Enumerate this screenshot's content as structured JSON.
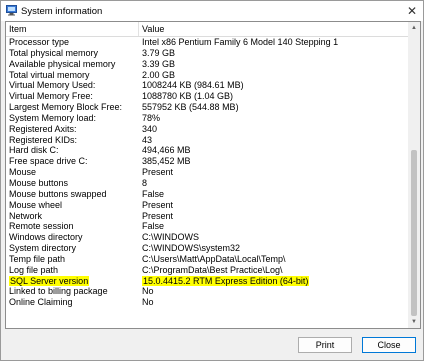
{
  "window": {
    "title": "System information",
    "close_glyph": "✕"
  },
  "table": {
    "columns": {
      "item": "Item",
      "value": "Value"
    },
    "rows": [
      {
        "item": "Processor type",
        "value": "Intel x86 Pentium Family 6 Model 140 Stepping 1"
      },
      {
        "item": "Total physical memory",
        "value": "3.79 GB"
      },
      {
        "item": "Available physical memory",
        "value": "3.39 GB"
      },
      {
        "item": "Total virtual memory",
        "value": "2.00 GB"
      },
      {
        "item": "Virtual Memory Used:",
        "value": "1008244 KB (984.61 MB)"
      },
      {
        "item": "Virtual Memory Free:",
        "value": "1088780 KB (1.04 GB)"
      },
      {
        "item": "Largest Memory Block Free:",
        "value": "557952 KB (544.88 MB)"
      },
      {
        "item": "System Memory load:",
        "value": "78%"
      },
      {
        "item": "Registered Axits:",
        "value": "340"
      },
      {
        "item": "Registered KIDs:",
        "value": "43"
      },
      {
        "item": "Hard disk C:",
        "value": "494,466 MB"
      },
      {
        "item": "Free space drive C:",
        "value": "385,452 MB"
      },
      {
        "item": "Mouse",
        "value": "Present"
      },
      {
        "item": "Mouse buttons",
        "value": "8"
      },
      {
        "item": "Mouse buttons swapped",
        "value": "False"
      },
      {
        "item": "Mouse wheel",
        "value": "Present"
      },
      {
        "item": "Network",
        "value": "Present"
      },
      {
        "item": "Remote session",
        "value": "False"
      },
      {
        "item": "Windows directory",
        "value": "C:\\WINDOWS"
      },
      {
        "item": "System directory",
        "value": "C:\\WINDOWS\\system32"
      },
      {
        "item": "Temp file path",
        "value": "C:\\Users\\Matt\\AppData\\Local\\Temp\\"
      },
      {
        "item": "Log file path",
        "value": "C:\\ProgramData\\Best Practice\\Log\\"
      },
      {
        "item": "SQL Server version",
        "value": "15.0.4415.2 RTM Express Edition (64-bit)",
        "highlighted": true
      },
      {
        "item": "Linked to billing package",
        "value": "No"
      },
      {
        "item": "Online Claiming",
        "value": "No"
      }
    ]
  },
  "buttons": {
    "print": "Print",
    "close": "Close"
  },
  "colors": {
    "highlight": "#ffff00",
    "focus_border": "#0078d7"
  },
  "icons": {
    "app": "computer-info-icon",
    "scroll_up": "scroll-up-arrow-icon",
    "scroll_down": "scroll-down-arrow-icon"
  }
}
